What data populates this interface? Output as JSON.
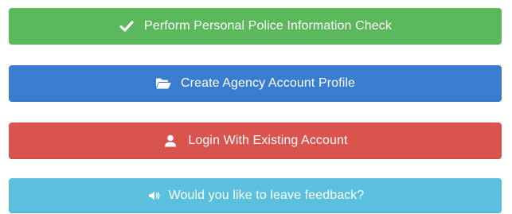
{
  "buttons": [
    {
      "label": "Perform Personal Police Information Check",
      "icon": "checkmark-icon",
      "color": "#5cb85c"
    },
    {
      "label": "Create Agency Account Profile",
      "icon": "folder-open-icon",
      "color": "#3a7ccf"
    },
    {
      "label": "Login With Existing Account",
      "icon": "user-icon",
      "color": "#d9534f"
    },
    {
      "label": "Would you like to leave feedback?",
      "icon": "volume-icon",
      "color": "#5bc0de"
    }
  ]
}
